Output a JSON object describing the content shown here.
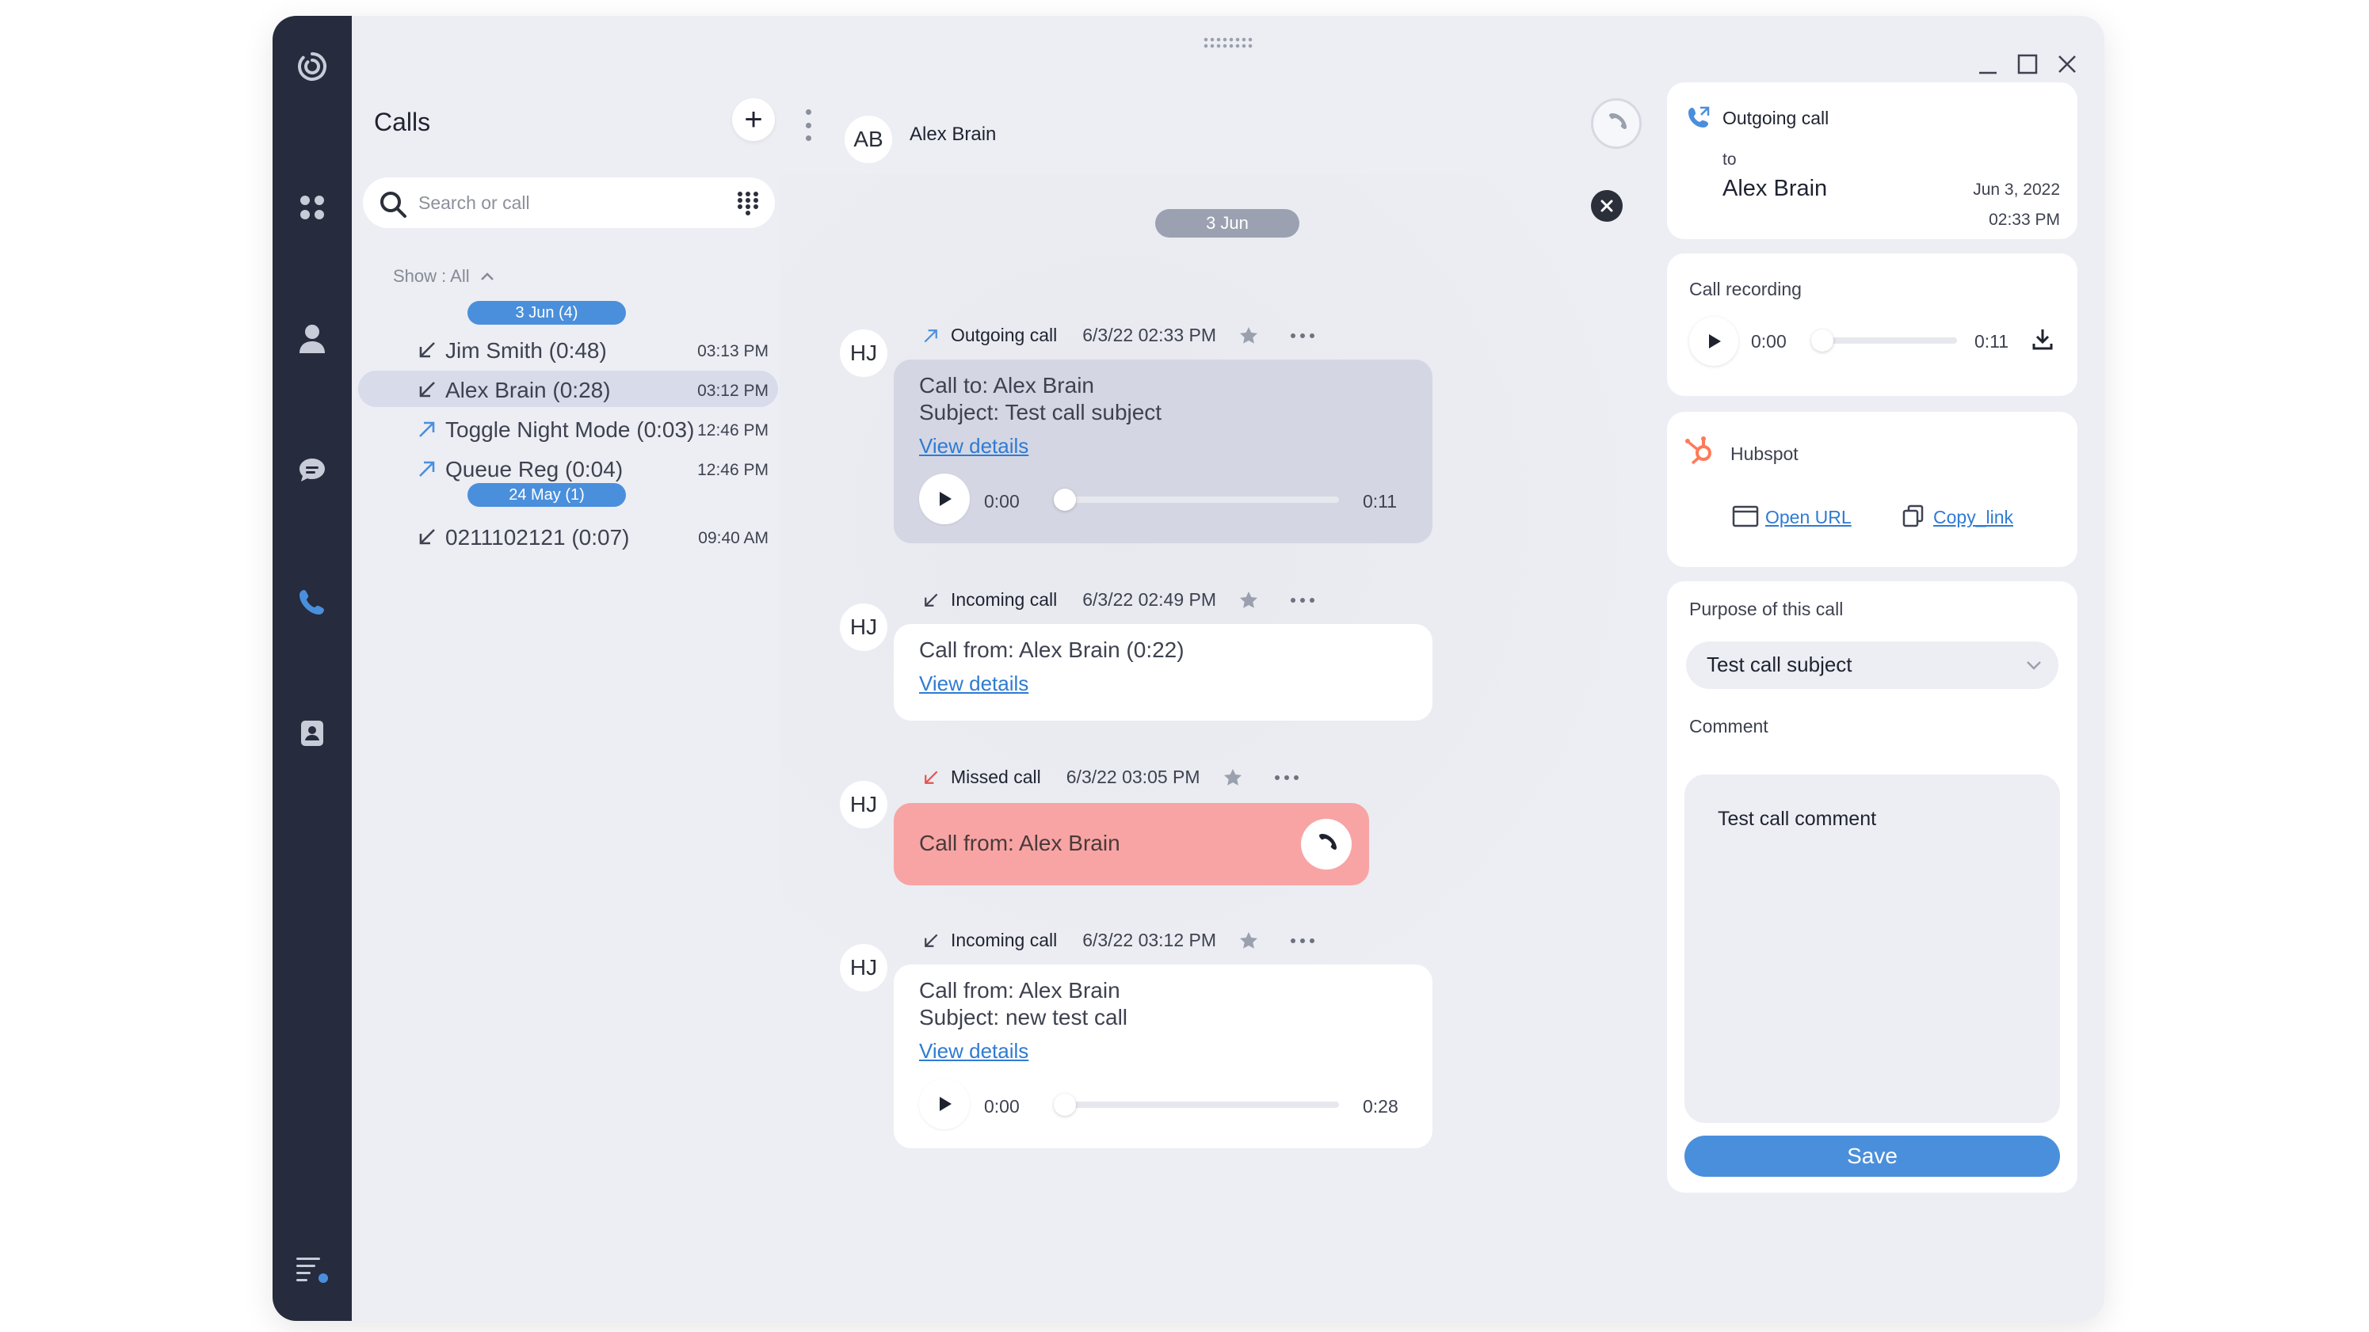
{
  "sidebar": {
    "icons": [
      "logo-icon",
      "apps-icon",
      "profile-icon",
      "chat-icon",
      "phone-icon",
      "contacts-icon",
      "menu-icon"
    ]
  },
  "calls_panel": {
    "title": "Calls",
    "search_placeholder": "Search or call",
    "filter_label": "Show : All",
    "groups": [
      {
        "date_label": "3 Jun (4)",
        "items": [
          {
            "name": "Jim Smith  (0:48)",
            "time": "03:13 PM",
            "direction": "incoming"
          },
          {
            "name": "Alex Brain  (0:28)",
            "time": "03:12 PM",
            "direction": "incoming",
            "selected": true
          },
          {
            "name": "Toggle Night Mode  (0:03)",
            "time": "12:46 PM",
            "direction": "outgoing"
          },
          {
            "name": "Queue Reg  (0:04)",
            "time": "12:46 PM",
            "direction": "outgoing"
          }
        ]
      },
      {
        "date_label": "24 May (1)",
        "items": [
          {
            "name": "0211102121  (0:07)",
            "time": "09:40 AM",
            "direction": "incoming"
          }
        ]
      }
    ]
  },
  "chat": {
    "contact_initials": "AB",
    "contact_name": "Alex Brain",
    "day_label": "3 Jun",
    "messages": [
      {
        "avatar": "HJ",
        "type": "Outgoing call",
        "when": "6/3/22 02:33 PM",
        "line1": "Call to: Alex Brain",
        "line2": "Subject: Test call subject",
        "link": "View details",
        "player": {
          "start": "0:00",
          "end": "0:11"
        }
      },
      {
        "avatar": "HJ",
        "type": "Incoming call",
        "when": "6/3/22 02:49 PM",
        "line1": "Call from: Alex Brain  (0:22)",
        "link": "View details"
      },
      {
        "avatar": "HJ",
        "type": "Missed call",
        "when": "6/3/22 03:05 PM",
        "line1": "Call from: Alex Brain"
      },
      {
        "avatar": "HJ",
        "type": "Incoming call",
        "when": "6/3/22 03:12 PM",
        "line1": "Call from: Alex Brain",
        "line2": "Subject: new test call",
        "link": "View details",
        "player": {
          "start": "0:00",
          "end": "0:28"
        }
      }
    ]
  },
  "details": {
    "call_type": "Outgoing call",
    "to_label": "to",
    "to_name": "Alex Brain",
    "date": "Jun 3, 2022",
    "time": "02:33 PM",
    "recording": {
      "title": "Call recording",
      "start": "0:00",
      "end": "0:11"
    },
    "hubspot": {
      "title": "Hubspot",
      "open_url": "Open URL",
      "copy_link": "Copy_link"
    },
    "purpose_label": "Purpose of this call",
    "purpose_value": "Test call subject",
    "comment_label": "Comment",
    "comment_value": "Test call comment",
    "save_label": "Save"
  },
  "colors": {
    "rail": "#262b3d",
    "accent": "#4a8fdc",
    "missed_bg": "#f8a4a4",
    "highlight_bg": "#d4d7e3",
    "app_bg": "#eceef3"
  }
}
